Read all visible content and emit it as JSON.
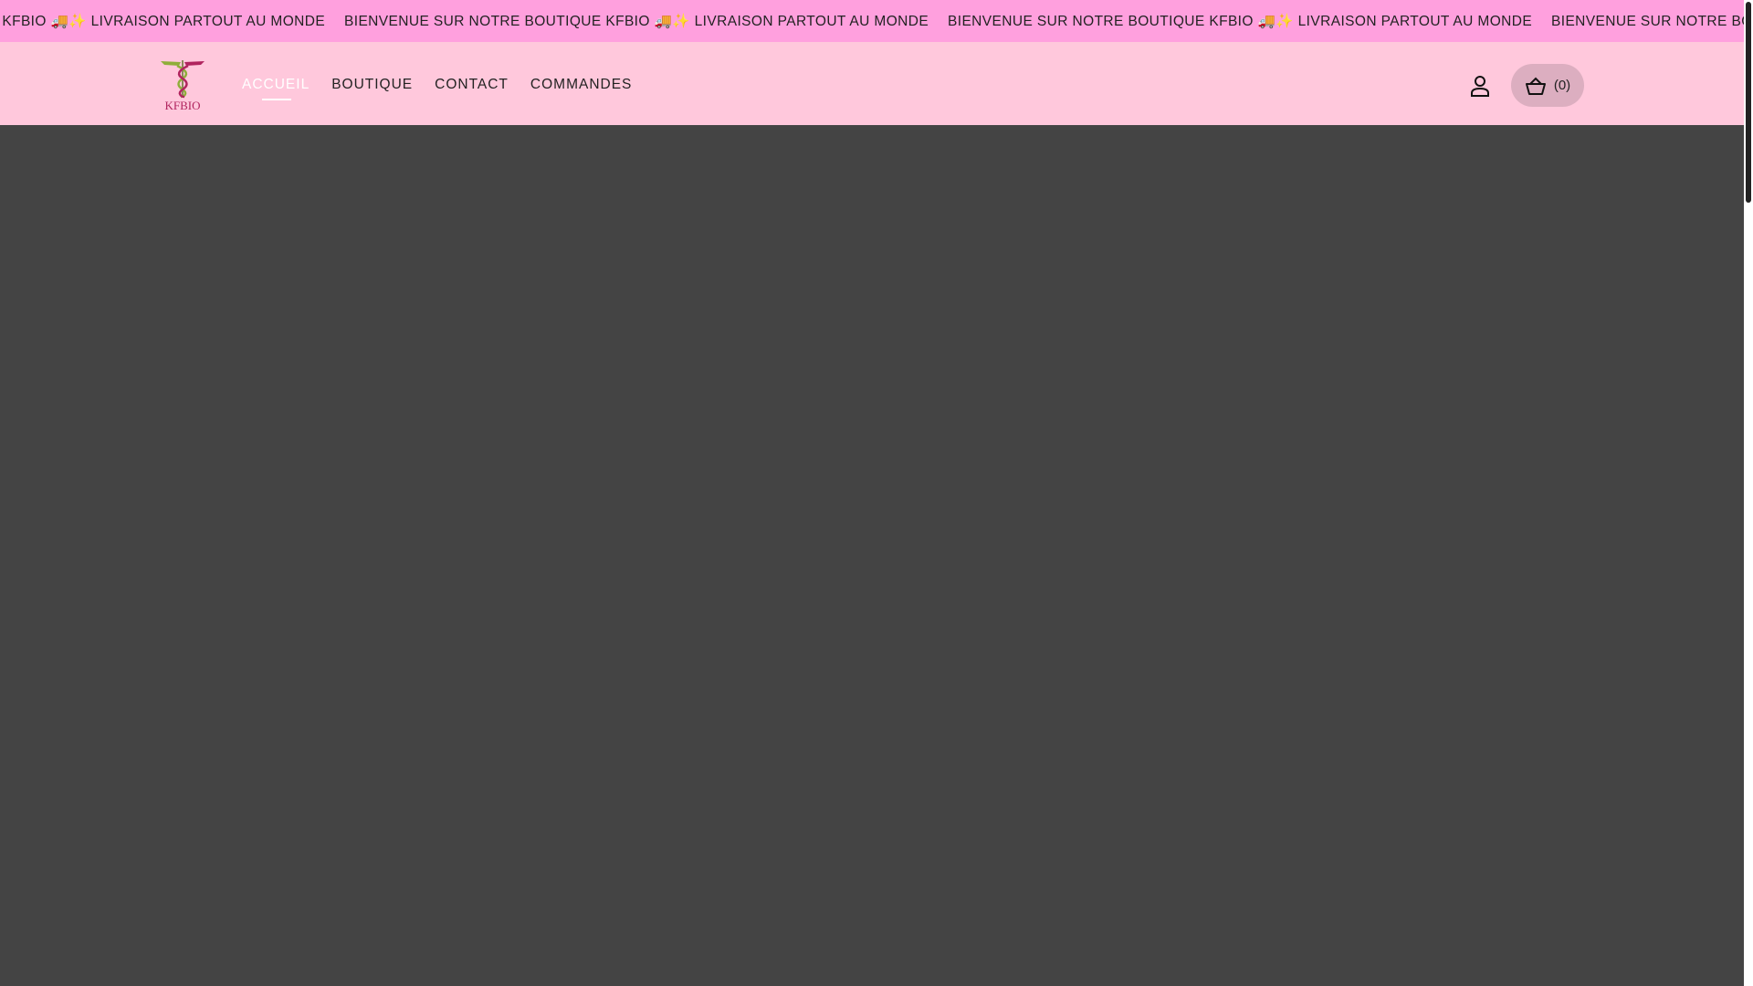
{
  "announcement": {
    "messages": [
      "BIENVENUE SUR NOTRE BOUTIQUE KFBIO 🚚✨ LIVRAISON PARTOUT AU MONDE",
      "BIENVENUE SUR NOTRE BOUTIQUE KFBIO 🚚✨ LIVRAISON PARTOUT AU MONDE",
      "BIENVENUE SUR NOTRE BOUTIQUE KFBIO 🚚✨ LIVRAISON PARTOUT AU MONDE",
      "BIENVENUE SUR NOTRE BOUTIQUE KFBIO 🚚✨ LIVRAISON PARTOUT AU MONDE"
    ]
  },
  "header": {
    "logo_text": "KFBIO",
    "nav": [
      "ACCUEIL",
      "BOUTIQUE",
      "CONTACT",
      "COMMANDES"
    ],
    "cart_count": "(0)"
  },
  "colors": {
    "topbar": "#ffa0de",
    "header": "#ffc8dc",
    "main": "#444444"
  }
}
